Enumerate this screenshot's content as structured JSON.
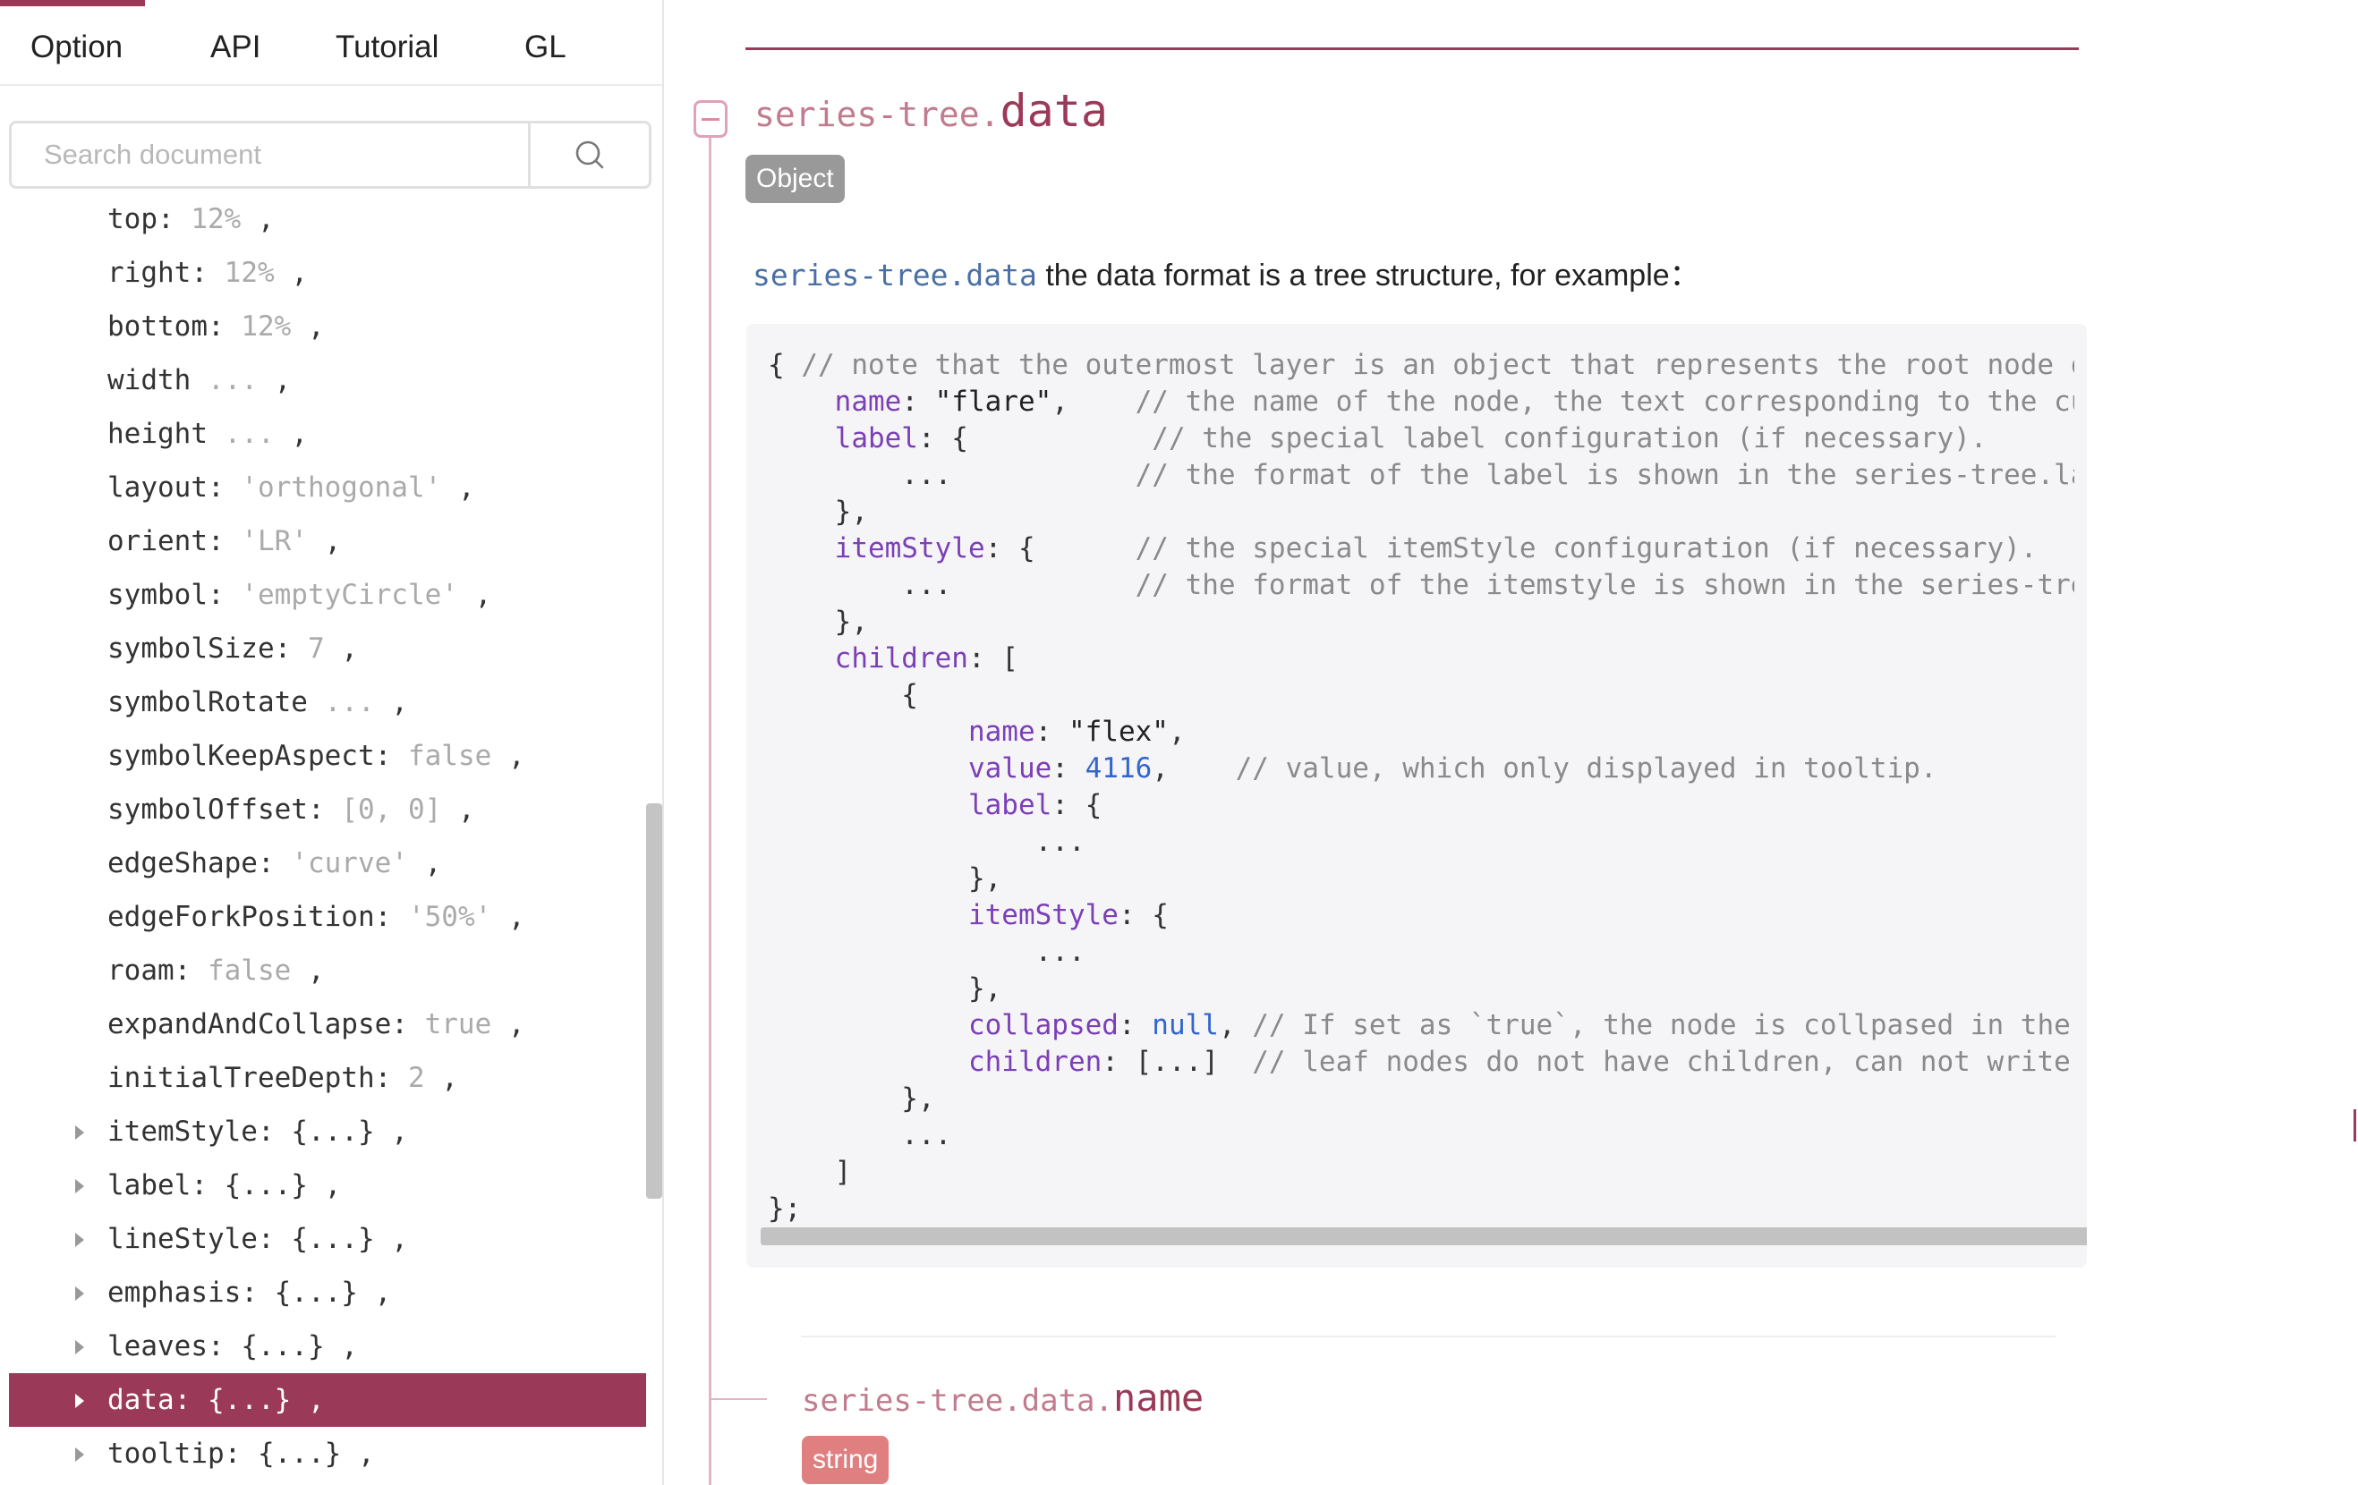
{
  "tabs": [
    {
      "label": "Option"
    },
    {
      "label": "API"
    },
    {
      "label": "Tutorial"
    },
    {
      "label": "GL"
    }
  ],
  "search": {
    "placeholder": "Search document"
  },
  "tree_items": [
    {
      "key": "top",
      "value": "12%",
      "expandable": false
    },
    {
      "key": "right",
      "value": "12%",
      "expandable": false
    },
    {
      "key": "bottom",
      "value": "12%",
      "expandable": false
    },
    {
      "key": "width",
      "value": "...",
      "expandable": false
    },
    {
      "key": "height",
      "value": "...",
      "expandable": false
    },
    {
      "key": "layout",
      "value": "'orthogonal'",
      "expandable": false
    },
    {
      "key": "orient",
      "value": "'LR'",
      "expandable": false
    },
    {
      "key": "symbol",
      "value": "'emptyCircle'",
      "expandable": false
    },
    {
      "key": "symbolSize",
      "value": "7",
      "expandable": false
    },
    {
      "key": "symbolRotate",
      "value": "...",
      "expandable": false
    },
    {
      "key": "symbolKeepAspect",
      "value": "false",
      "expandable": false
    },
    {
      "key": "symbolOffset",
      "value": "[0, 0]",
      "expandable": false
    },
    {
      "key": "edgeShape",
      "value": "'curve'",
      "expandable": false
    },
    {
      "key": "edgeForkPosition",
      "value": "'50%'",
      "expandable": false
    },
    {
      "key": "roam",
      "value": "false",
      "expandable": false
    },
    {
      "key": "expandAndCollapse",
      "value": "true",
      "expandable": false
    },
    {
      "key": "initialTreeDepth",
      "value": "2",
      "expandable": false
    },
    {
      "key": "itemStyle",
      "value": "{...}",
      "expandable": true
    },
    {
      "key": "label",
      "value": "{...}",
      "expandable": true
    },
    {
      "key": "lineStyle",
      "value": "{...}",
      "expandable": true
    },
    {
      "key": "emphasis",
      "value": "{...}",
      "expandable": true
    },
    {
      "key": "leaves",
      "value": "{...}",
      "expandable": true
    },
    {
      "key": "data",
      "value": "{...}",
      "expandable": true,
      "active": true
    },
    {
      "key": "tooltip",
      "value": "{...}",
      "expandable": true
    }
  ],
  "section": {
    "prefix": "series-tree.",
    "name": "data",
    "type": "Object",
    "desc_code": "series-tree.data",
    "desc_text": "the data format is a tree structure, for example："
  },
  "code_lines": [
    [
      [
        "p",
        "{ "
      ],
      [
        "cm",
        "// note that the outermost layer is an object that represents the root node of the tree."
      ]
    ],
    [
      [
        "p",
        "    "
      ],
      [
        "ky",
        "name"
      ],
      [
        "p",
        ": "
      ],
      [
        "st",
        "\"flare\""
      ],
      [
        "p",
        ",    "
      ],
      [
        "cm",
        "// the name of the node, the text corresponding to the current node label."
      ]
    ],
    [
      [
        "p",
        "    "
      ],
      [
        "ky",
        "label"
      ],
      [
        "p",
        ": {           "
      ],
      [
        "cm",
        "// the special label configuration (if necessary)."
      ]
    ],
    [
      [
        "p",
        "        ...           "
      ],
      [
        "cm",
        "// the format of the label is shown in the series-tree.label."
      ]
    ],
    [
      [
        "p",
        "    },"
      ]
    ],
    [
      [
        "p",
        "    "
      ],
      [
        "ky",
        "itemStyle"
      ],
      [
        "p",
        ": {      "
      ],
      [
        "cm",
        "// the special itemStyle configuration (if necessary)."
      ]
    ],
    [
      [
        "p",
        "        ...           "
      ],
      [
        "cm",
        "// the format of the itemstyle is shown in the series-tree.itemStyle."
      ]
    ],
    [
      [
        "p",
        "    },"
      ]
    ],
    [
      [
        "p",
        "    "
      ],
      [
        "ky",
        "children"
      ],
      [
        "p",
        ": ["
      ]
    ],
    [
      [
        "p",
        "        {"
      ]
    ],
    [
      [
        "p",
        "            "
      ],
      [
        "ky",
        "name"
      ],
      [
        "p",
        ": "
      ],
      [
        "st",
        "\"flex\""
      ],
      [
        "p",
        ","
      ]
    ],
    [
      [
        "p",
        "            "
      ],
      [
        "ky",
        "value"
      ],
      [
        "p",
        ": "
      ],
      [
        "nm",
        "4116"
      ],
      [
        "p",
        ",    "
      ],
      [
        "cm",
        "// value, which only displayed in tooltip."
      ]
    ],
    [
      [
        "p",
        "            "
      ],
      [
        "ky",
        "label"
      ],
      [
        "p",
        ": {"
      ]
    ],
    [
      [
        "p",
        "                ..."
      ]
    ],
    [
      [
        "p",
        "            },"
      ]
    ],
    [
      [
        "p",
        "            "
      ],
      [
        "ky",
        "itemStyle"
      ],
      [
        "p",
        ": {"
      ]
    ],
    [
      [
        "p",
        "                ..."
      ]
    ],
    [
      [
        "p",
        "            },"
      ]
    ],
    [
      [
        "p",
        "            "
      ],
      [
        "ky",
        "collapsed"
      ],
      [
        "p",
        ": "
      ],
      [
        "kw",
        "null"
      ],
      [
        "p",
        ", "
      ],
      [
        "cm",
        "// If set as `true`, the node is collpased in the initialization."
      ]
    ],
    [
      [
        "p",
        "            "
      ],
      [
        "ky",
        "children"
      ],
      [
        "p",
        ": [...]  "
      ],
      [
        "cm",
        "// leaf nodes do not have children, can not write."
      ]
    ],
    [
      [
        "p",
        "        },"
      ]
    ],
    [
      [
        "p",
        "        ..."
      ]
    ],
    [
      [
        "p",
        "    ]"
      ]
    ],
    [
      [
        "p",
        "};"
      ]
    ]
  ],
  "subsection": {
    "prefix": "series-tree.data.",
    "name": "name",
    "type": "string"
  },
  "colors": {
    "accent": "#9b3a58",
    "badge_object": "#999999",
    "badge_string": "#e07f80",
    "code_bg": "#f5f5f8"
  },
  "icons": {
    "search": "search-icon",
    "collapse": "collapse-minus-icon",
    "expand": "expand-arrow-icon"
  }
}
